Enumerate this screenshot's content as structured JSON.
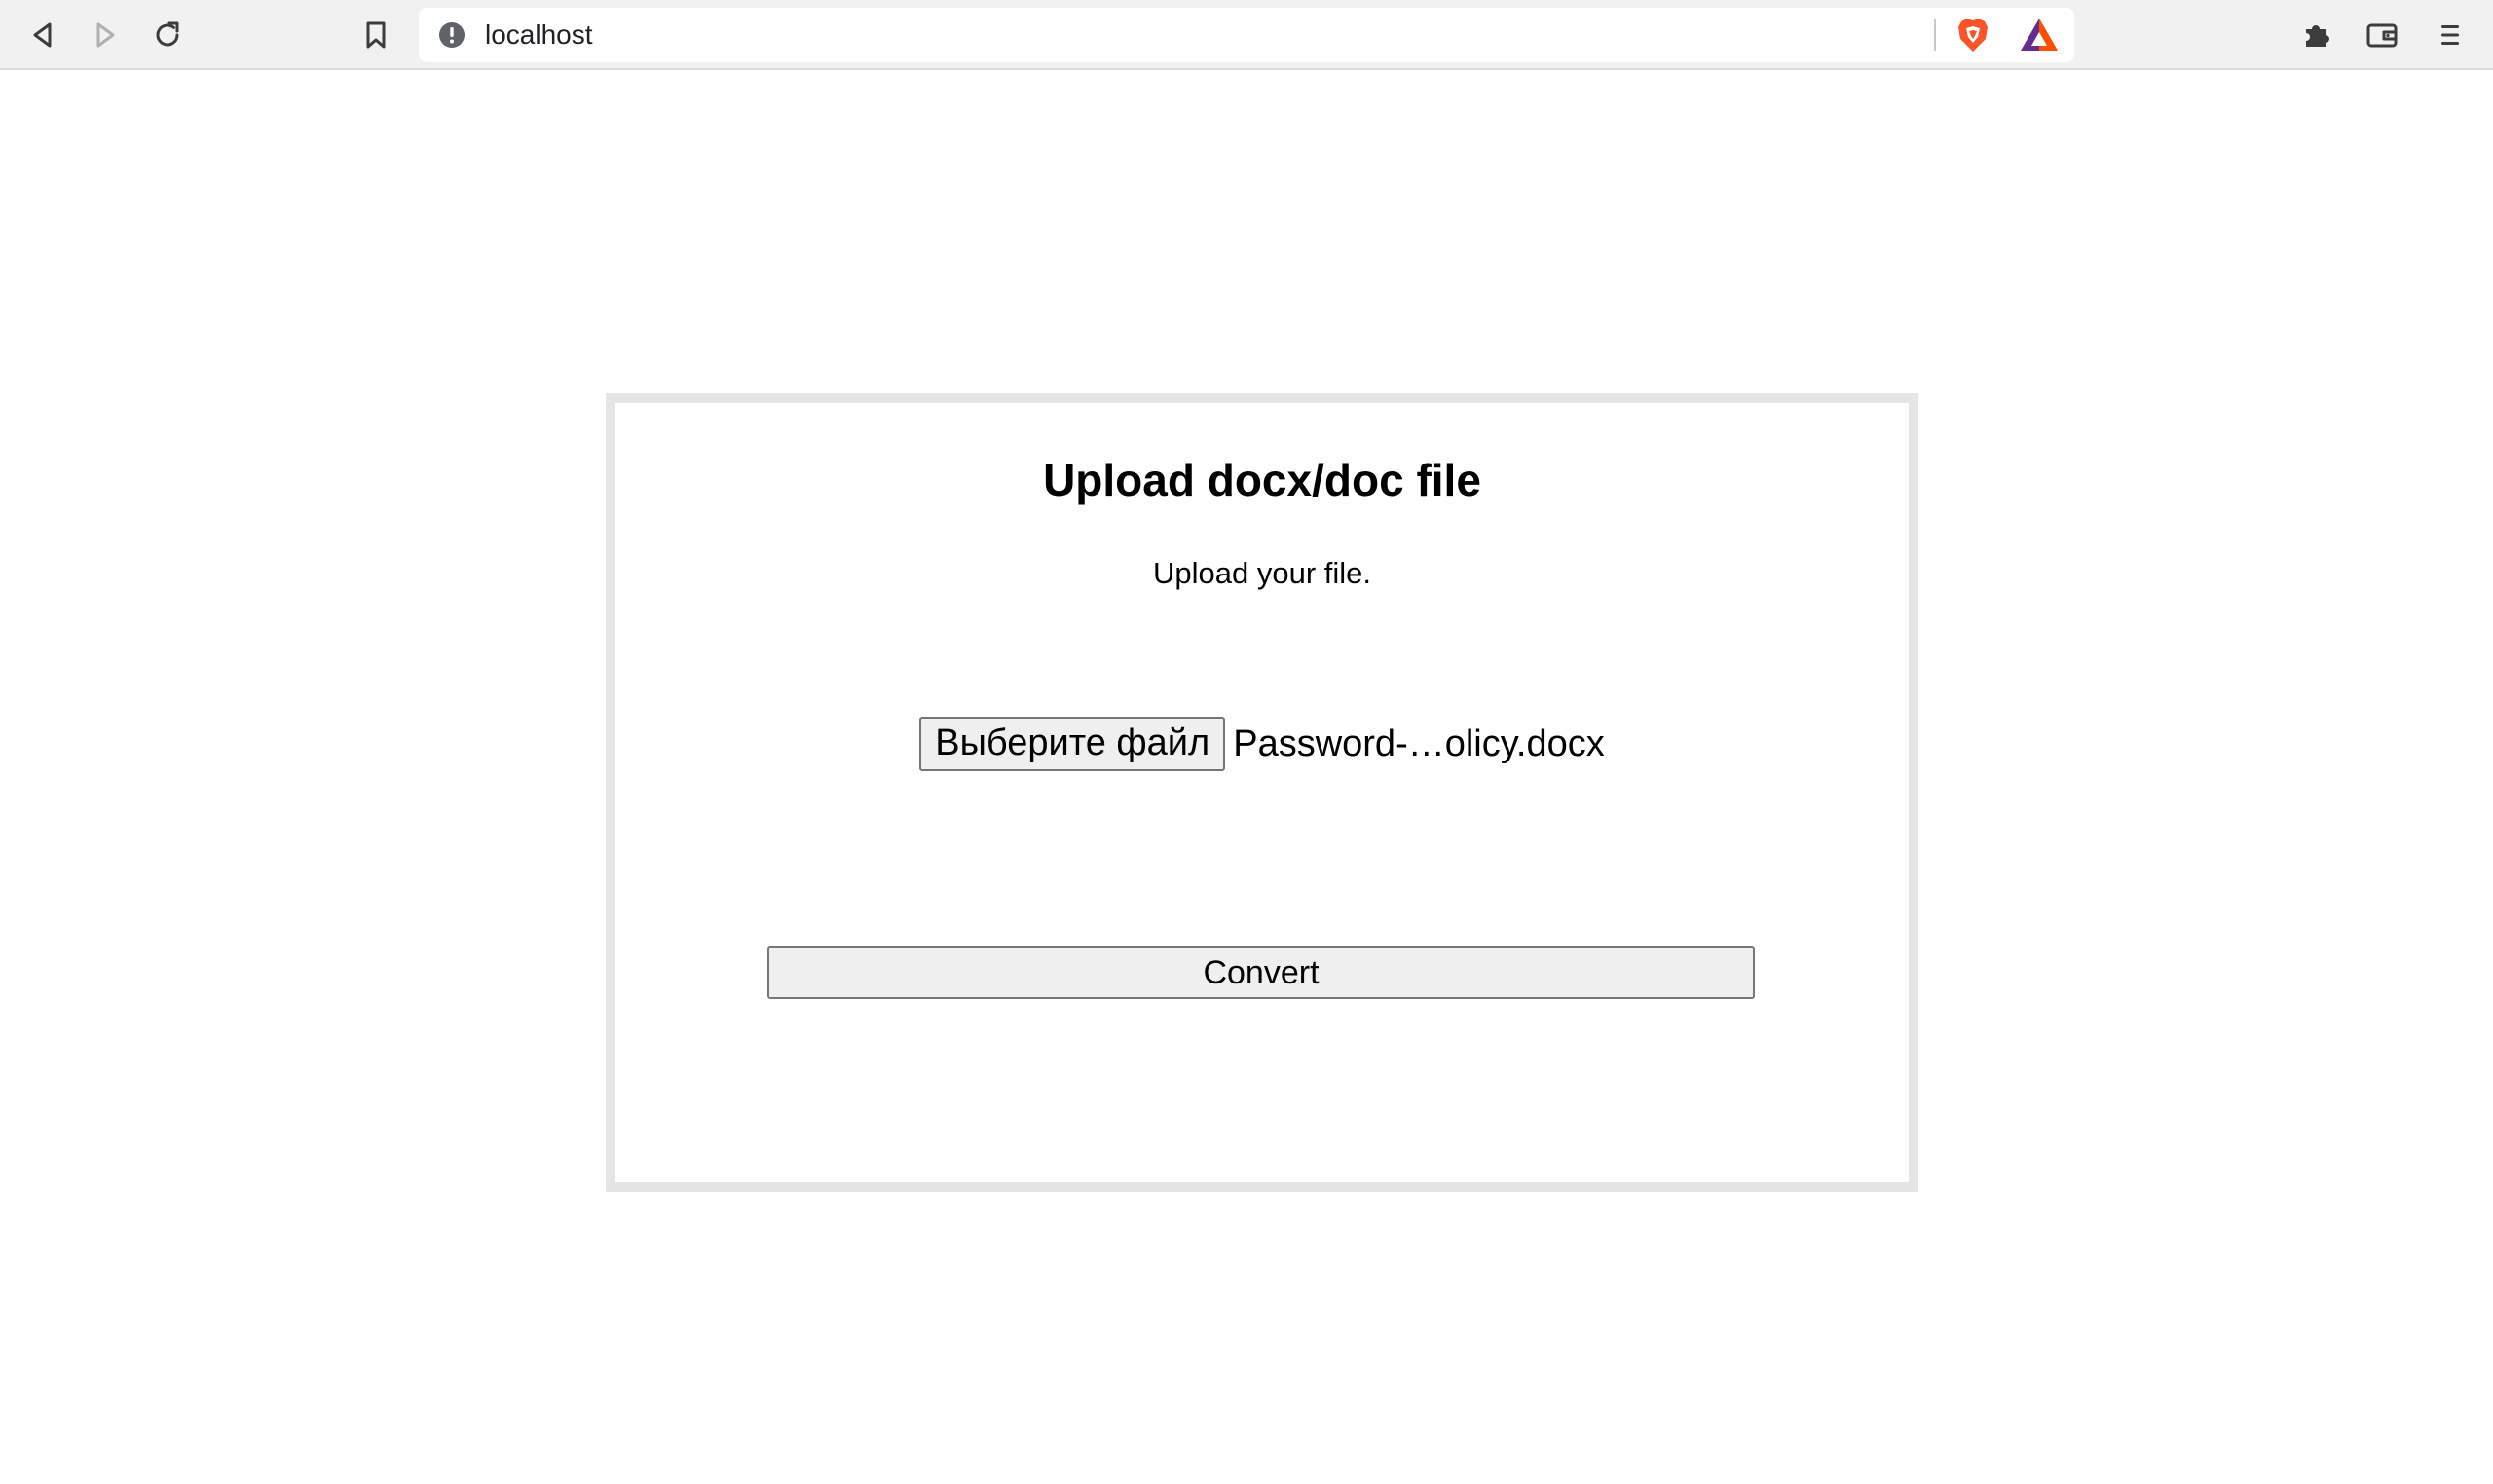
{
  "browser": {
    "url": "localhost",
    "icons": {
      "back": "back-arrow-icon",
      "forward": "forward-arrow-icon",
      "reload": "reload-icon",
      "bookmark": "bookmark-icon",
      "site_info": "info-icon",
      "brave_shields": "brave-shields-icon",
      "brave_rewards": "brave-rewards-icon",
      "extensions": "puzzle-icon",
      "wallet": "wallet-icon",
      "menu": "hamburger-menu-icon"
    },
    "colors": {
      "toolbar_bg": "#f1f1f2",
      "brave_orange": "#fb542b",
      "rewards_purple": "#662d91"
    }
  },
  "page": {
    "title": "Upload docx/doc file",
    "subtitle": "Upload your file.",
    "file_input": {
      "button_label": "Выберите файл",
      "file_name": "Password-…olicy.docx"
    },
    "convert_label": "Convert"
  }
}
